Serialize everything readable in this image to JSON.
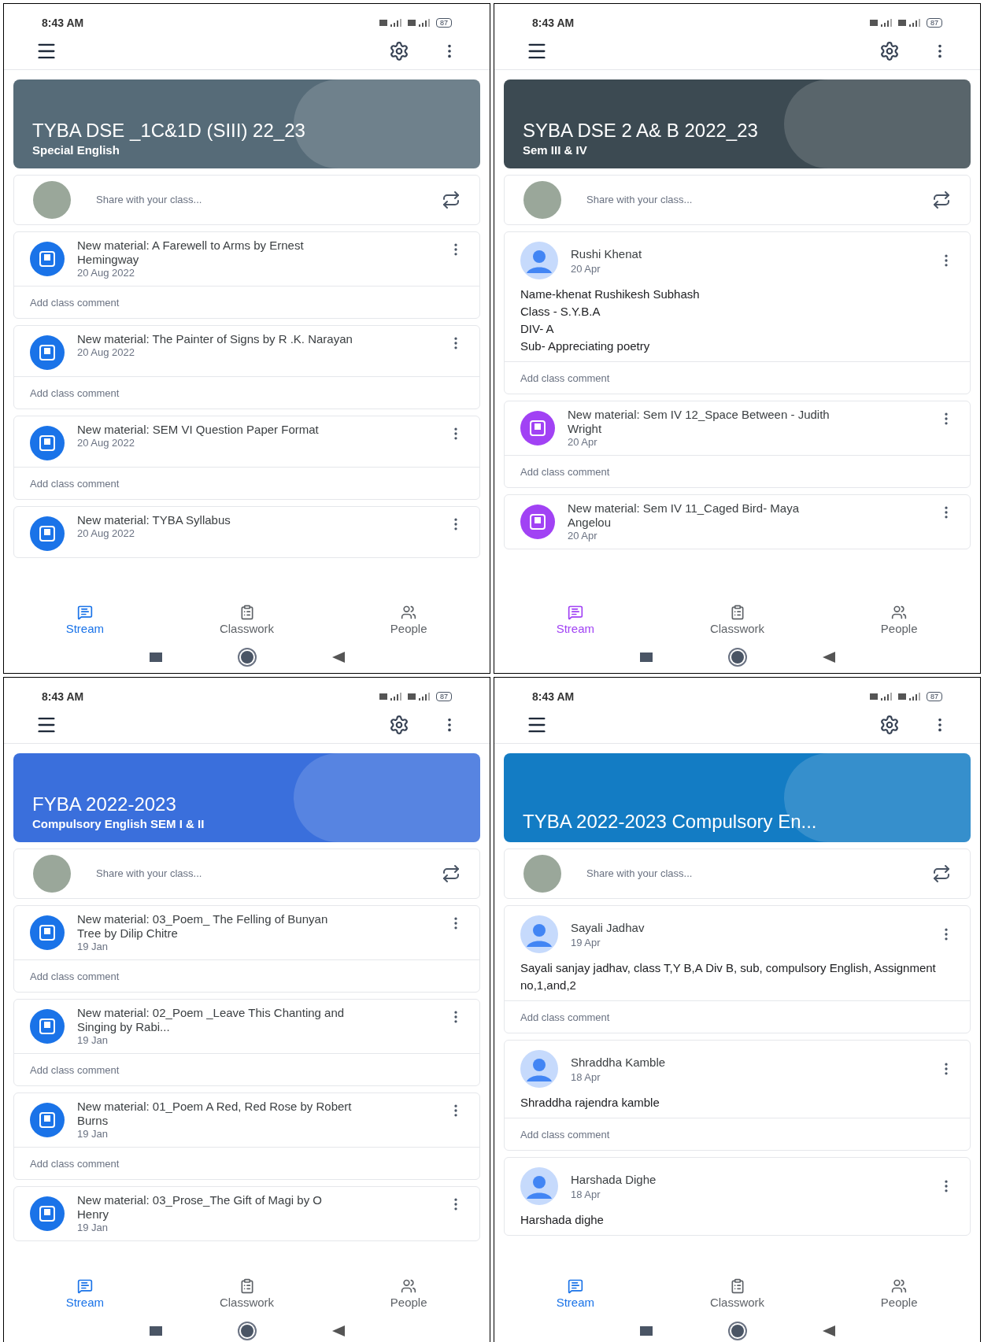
{
  "screens": [
    {
      "status_bar": {
        "time": "8:43 AM",
        "battery": "87"
      },
      "color": "#1a73e8",
      "banner": {
        "title": "TYBA DSE _1C&1D (SIII) 22_23",
        "subtitle": "Special English",
        "color": "#566b78"
      },
      "share": {
        "placeholder": "Share with your class..."
      },
      "posts": [
        {
          "kind": "material",
          "title": "New material: A Farewell to Arms by Ernest Hemingway",
          "date": "20 Aug 2022",
          "comment": "Add class comment"
        },
        {
          "kind": "material",
          "title": "New material: The Painter of Signs by R .K. Narayan",
          "date": "20 Aug 2022",
          "comment": "Add class comment"
        },
        {
          "kind": "material",
          "title": "New material: SEM VI Question Paper Format",
          "date": "20 Aug 2022",
          "comment": "Add class comment"
        },
        {
          "kind": "material",
          "title": "New material: TYBA Syllabus",
          "date": "20 Aug 2022"
        }
      ],
      "tabs": [
        {
          "label": "Stream",
          "selected": true
        },
        {
          "label": "Classwork",
          "selected": false
        },
        {
          "label": "People",
          "selected": false
        }
      ]
    },
    {
      "status_bar": {
        "time": "8:43 AM",
        "battery": "87"
      },
      "color": "#a142f4",
      "banner": {
        "title": "SYBA DSE 2 A& B 2022_23",
        "subtitle": "Sem III & IV",
        "color": "#3c4a52"
      },
      "share": {
        "placeholder": "Share with your class..."
      },
      "posts": [
        {
          "kind": "announcement",
          "author": "Rushi Khenat",
          "date": "20 Apr",
          "body": [
            "Name-khenat Rushikesh Subhash",
            "Class - S.Y.B.A",
            "DIV- A",
            "Sub- Appreciating poetry"
          ],
          "comment": "Add class comment"
        },
        {
          "kind": "material",
          "title": "New material: Sem IV 12_Space Between - Judith Wright",
          "date": "20 Apr",
          "comment": "Add class comment"
        },
        {
          "kind": "material",
          "title": "New material: Sem IV 11_Caged Bird- Maya Angelou",
          "date": "20 Apr"
        }
      ],
      "tabs": [
        {
          "label": "Stream",
          "selected": true
        },
        {
          "label": "Classwork",
          "selected": false
        },
        {
          "label": "People",
          "selected": false
        }
      ]
    },
    {
      "status_bar": {
        "time": "8:43 AM",
        "battery": "87"
      },
      "color": "#1a73e8",
      "banner": {
        "title": "FYBA 2022-2023",
        "subtitle": "Compulsory English SEM I & II",
        "color": "#3a6fdc"
      },
      "share": {
        "placeholder": "Share with your class..."
      },
      "posts": [
        {
          "kind": "material",
          "title": "New material: 03_Poem_ The Felling of Bunyan Tree by Dilip Chitre",
          "date": "19 Jan",
          "comment": "Add class comment"
        },
        {
          "kind": "material",
          "title": "New material: 02_Poem _Leave This Chanting and Singing by Rabi...",
          "date": "19 Jan",
          "comment": "Add class comment"
        },
        {
          "kind": "material",
          "title": "New material: 01_Poem A Red, Red Rose by Robert Burns",
          "date": "19 Jan",
          "comment": "Add class comment"
        },
        {
          "kind": "material",
          "title": "New material: 03_Prose_The Gift of Magi by O Henry",
          "date": "19 Jan"
        }
      ],
      "tabs": [
        {
          "label": "Stream",
          "selected": true
        },
        {
          "label": "Classwork",
          "selected": false
        },
        {
          "label": "People",
          "selected": false
        }
      ]
    },
    {
      "status_bar": {
        "time": "8:43 AM",
        "battery": "87"
      },
      "color": "#1a73e8",
      "banner": {
        "title": "TYBA 2022-2023 Compulsory En...",
        "color": "#137cc4"
      },
      "share": {
        "placeholder": "Share with your class..."
      },
      "posts": [
        {
          "kind": "announcement",
          "author": "Sayali Jadhav",
          "date": "19 Apr",
          "body": [
            "Sayali sanjay jadhav, class T,Y B,A Div B, sub, compulsory English, Assignment no,1,and,2"
          ],
          "comment": "Add class comment"
        },
        {
          "kind": "announcement",
          "author": "Shraddha Kamble",
          "date": "18 Apr",
          "body": [
            "Shraddha rajendra kamble"
          ],
          "comment": "Add class comment"
        },
        {
          "kind": "announcement",
          "author": "Harshada Dighe",
          "date": "18 Apr",
          "body": [
            "Harshada dighe"
          ]
        }
      ],
      "tabs": [
        {
          "label": "Stream",
          "selected": true
        },
        {
          "label": "Classwork",
          "selected": false
        },
        {
          "label": "People",
          "selected": false
        }
      ]
    }
  ]
}
